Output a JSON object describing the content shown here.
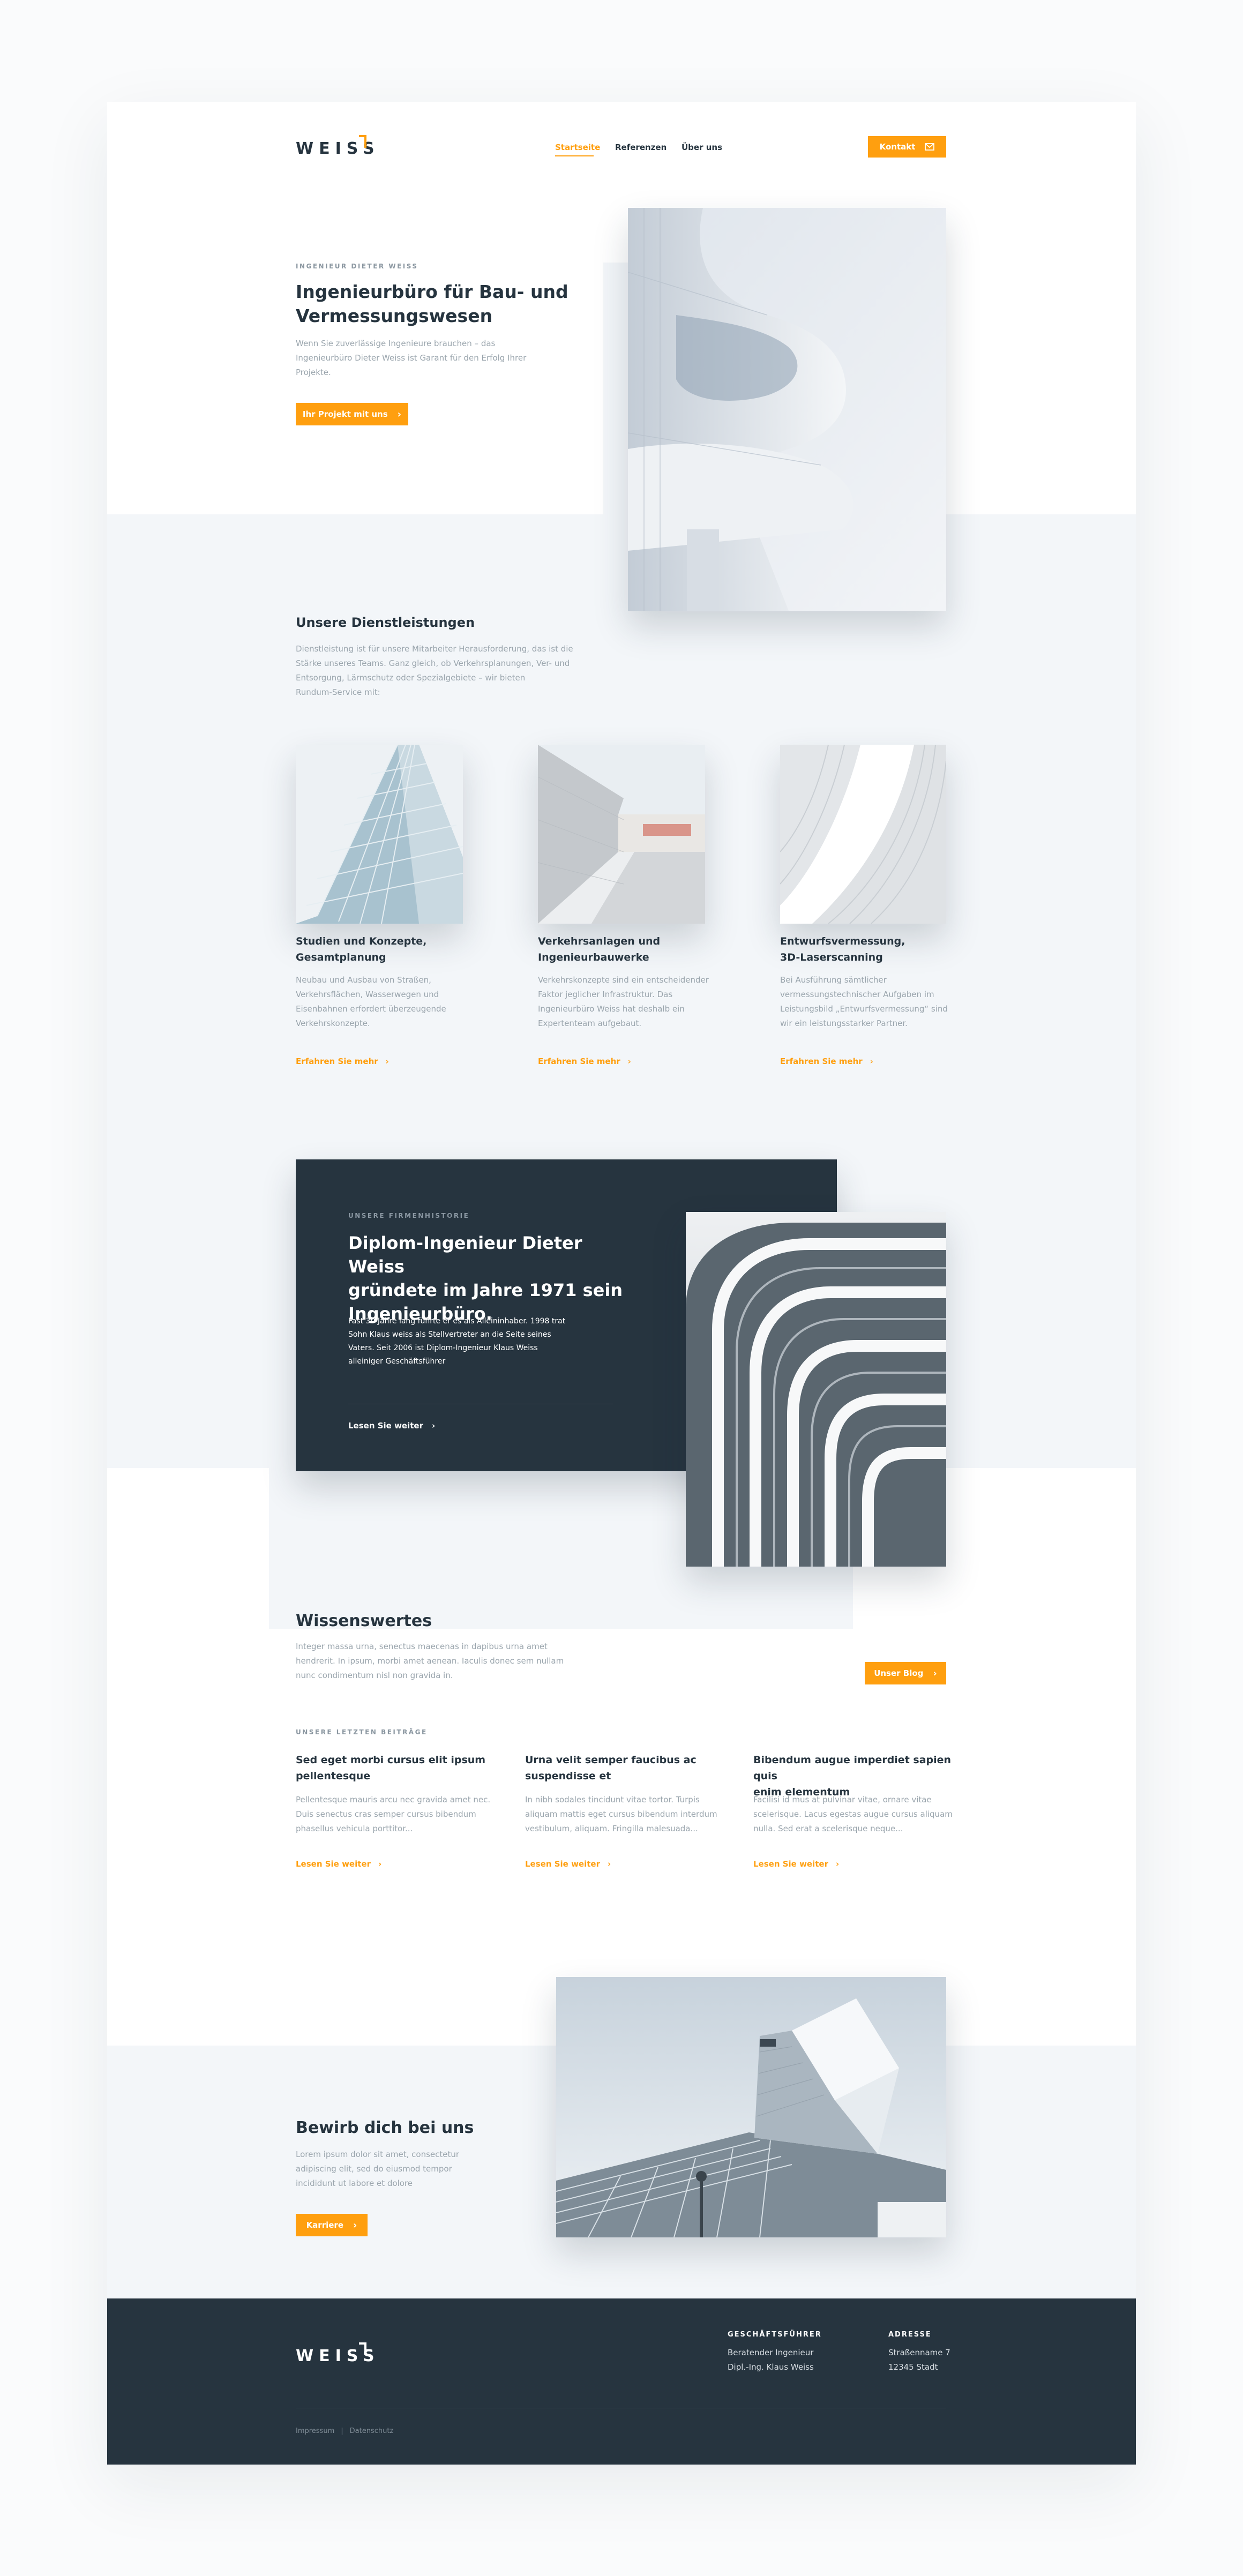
{
  "header": {
    "logo": "WEISS",
    "nav": [
      {
        "label": "Startseite",
        "active": true
      },
      {
        "label": "Referenzen",
        "active": false
      },
      {
        "label": "Über uns",
        "active": false
      }
    ],
    "contact_label": "Kontakt"
  },
  "hero": {
    "eyebrow": "INGENIEUR DIETER WEISS",
    "title_line1": "Ingenieurbüro für Bau- und",
    "title_line2": "Vermessungswesen",
    "text_line1": "Wenn Sie zuverlässige Ingenieure brauchen – das",
    "text_line2": "Ingenieurbüro Dieter Weiss ist Garant für den Erfolg Ihrer",
    "text_line3": "Projekte.",
    "cta": "Ihr Projekt mit uns"
  },
  "services": {
    "title": "Unsere Dienstleistungen",
    "text_line1": "Dienstleistung ist für unsere Mitarbeiter Herausforderung, das ist die",
    "text_line2": "Stärke unseres Teams. Ganz gleich, ob Verkehrsplanungen, Ver- und",
    "text_line3": "Entsorgung, Lärmschutz oder Spezialgebiete – wir bieten",
    "text_line4": "Rundum-Service mit:",
    "cards": [
      {
        "title_line1": "Studien und Konzepte,",
        "title_line2": "Gesamtplanung",
        "lines": [
          "Neubau und Ausbau von Straßen,",
          "Verkehrsflächen, Wasserwegen und",
          "Eisenbahnen erfordert überzeugende",
          "Verkehrskonzepte."
        ],
        "more": "Erfahren Sie mehr"
      },
      {
        "title_line1": "Verkehrsanlagen und",
        "title_line2": "Ingenieurbauwerke",
        "lines": [
          "Verkehrskonzepte sind ein entscheidender",
          "Faktor jeglicher Infrastruktur. Das",
          "Ingenieurbüro Weiss hat deshalb ein",
          "Expertenteam aufgebaut."
        ],
        "more": "Erfahren Sie mehr"
      },
      {
        "title_line1": "Entwurfsvermessung,",
        "title_line2": "3D-Laserscanning",
        "lines": [
          "Bei Ausführung sämtlicher",
          "vermessungstechnischer Aufgaben im",
          "Leistungsbild „Entwurfsvermessung“ sind",
          "wir ein leistungsstarker Partner."
        ],
        "more": "Erfahren Sie mehr"
      }
    ]
  },
  "history": {
    "eyebrow": "UNSERE FIRMENHISTORIE",
    "title_line1": "Diplom-Ingenieur Dieter Weiss",
    "title_line2": "gründete im Jahre 1971 sein",
    "title_line3": "Ingenieurbüro.",
    "lines": [
      "Fast 30 Jahre lang führte er es als Alleininhaber. 1998 trat",
      "Sohn Klaus weiss als Stellvertreter an die Seite seines",
      "Vaters. Seit 2006 ist Diplom-Ingenieur Klaus Weiss",
      "alleiniger Geschäftsführer"
    ],
    "more": "Lesen Sie weiter"
  },
  "blog": {
    "title": "Wissenswertes",
    "text_line1": "Integer massa urna, senectus maecenas in dapibus urna amet",
    "text_line2": "hendrerit. In ipsum, morbi amet aenean. Iaculis donec sem nullam",
    "text_line3": "nunc condimentum nisl non gravida in.",
    "cta": "Unser Blog",
    "section_label": "UNSERE LETZTEN BEITRÄGE",
    "posts": [
      {
        "title_line1": "Sed eget morbi cursus elit ipsum",
        "title_line2": "pellentesque",
        "lines": [
          "Pellentesque mauris arcu nec gravida amet nec.",
          "Duis senectus cras semper cursus bibendum",
          "phasellus vehicula porttitor..."
        ],
        "more": "Lesen Sie weiter"
      },
      {
        "title_line1": "Urna velit semper faucibus ac",
        "title_line2": "suspendisse et",
        "lines": [
          "In nibh sodales tincidunt vitae tortor. Turpis",
          "aliquam mattis eget cursus bibendum interdum",
          "vestibulum, aliquam. Fringilla malesuada..."
        ],
        "more": "Lesen Sie weiter"
      },
      {
        "title_line1": "Bibendum augue imperdiet sapien quis",
        "title_line2": "enim elementum",
        "lines": [
          "Facilisi id mus at pulvinar vitae, ornare vitae",
          "scelerisque. Lacus egestas augue cursus aliquam",
          "nulla. Sed erat a scelerisque neque..."
        ],
        "more": "Lesen Sie weiter"
      }
    ]
  },
  "career": {
    "title": "Bewirb dich bei uns",
    "text_line1": "Lorem ipsum dolor sit amet, consectetur",
    "text_line2": "adipiscing elit, sed do eiusmod tempor",
    "text_line3": "incididunt ut labore et dolore",
    "cta": "Karriere"
  },
  "footer": {
    "logo": "WEISS",
    "col1_head": "GESCHÄFTSFÜHRER",
    "col1_line1": "Beratender Ingenieur",
    "col1_line2": "Dipl.-Ing. Klaus Weiss",
    "col2_head": "ADRESSE",
    "col2_line1": "Straßenname 7",
    "col2_line2": "12345 Stadt",
    "legal1": "Impressum",
    "legal_sep": "|",
    "legal2": "Datenschutz"
  },
  "colors": {
    "accent": "#ff9f0f",
    "dark": "#26343f",
    "band": "#f3f6f9"
  }
}
